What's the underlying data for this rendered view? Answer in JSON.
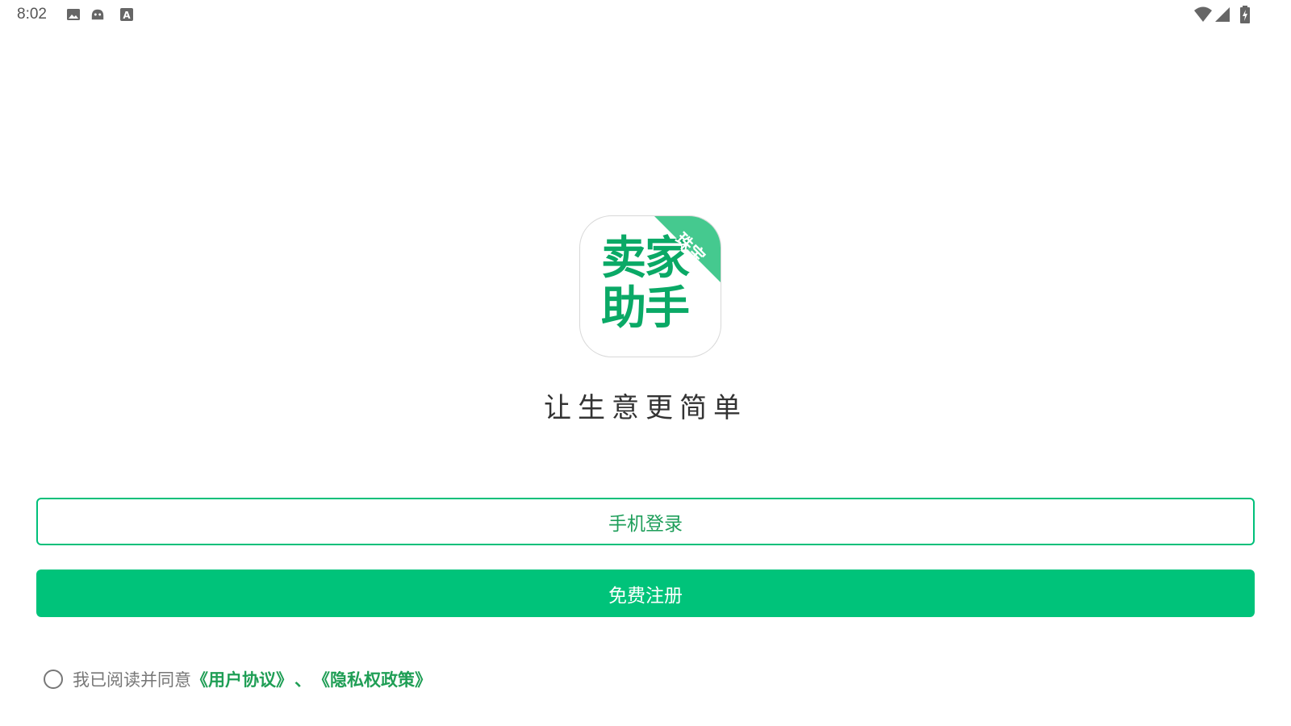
{
  "status_bar": {
    "time": "8:02",
    "icons": [
      "image-icon",
      "android-icon",
      "a-icon",
      "wifi-icon",
      "signal-icon",
      "battery-icon"
    ]
  },
  "logo": {
    "line1": "卖家",
    "line2": "助手",
    "ribbon": "珠宝",
    "colors": {
      "text": "#0aa966",
      "ribbon": "#45c98f"
    }
  },
  "slogan": "让生意更简单",
  "buttons": {
    "login": "手机登录",
    "register": "免费注册"
  },
  "agreement": {
    "prefix": "我已阅读并同意",
    "user_agreement": "《用户协议》",
    "separator": "、",
    "privacy_policy": "《隐私权政策》"
  },
  "colors": {
    "accent": "#00c37a",
    "link": "#1f9e55"
  }
}
